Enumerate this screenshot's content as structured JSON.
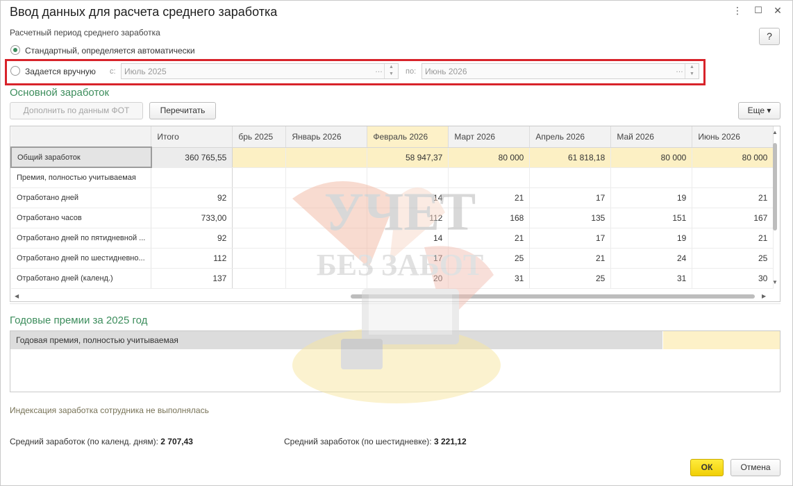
{
  "window": {
    "title": "Ввод данных для расчета среднего заработка",
    "controls": {
      "menu": "⋮",
      "minimize": "☐",
      "close": "✕"
    },
    "help": "?"
  },
  "period": {
    "label": "Расчетный период среднего заработка",
    "standard": "Стандартный, определяется автоматически",
    "manual": "Задается вручную",
    "from_label": "с:",
    "from_value": "Июль 2025",
    "to_label": "по:",
    "to_value": "Июнь 2026",
    "selected": "standard"
  },
  "main": {
    "title": "Основной заработок",
    "fill_button": "Дополнить по данным ФОТ",
    "recalc_button": "Перечитать",
    "more_button": "Еще ▾",
    "columns": [
      "",
      "Итого",
      "брь 2025",
      "Январь 2026",
      "Февраль 2026",
      "Март 2026",
      "Апрель 2026",
      "Май 2026",
      "Июнь 2026"
    ],
    "rows": [
      {
        "name": "Общий заработок",
        "total": "360 765,55",
        "cells": [
          "",
          "",
          "58 947,37",
          "80 000",
          "61 818,18",
          "80 000",
          "80 000"
        ]
      },
      {
        "name": "Премия, полностью учитываемая",
        "total": "",
        "cells": [
          "",
          "",
          "",
          "",
          "",
          "",
          ""
        ]
      },
      {
        "name": "Отработано дней",
        "total": "92",
        "cells": [
          "",
          "",
          "14",
          "21",
          "17",
          "19",
          "21"
        ]
      },
      {
        "name": "Отработано часов",
        "total": "733,00",
        "cells": [
          "",
          "",
          "112",
          "168",
          "135",
          "151",
          "167"
        ]
      },
      {
        "name": "Отработано дней по пятидневной ...",
        "total": "92",
        "cells": [
          "",
          "",
          "14",
          "21",
          "17",
          "19",
          "21"
        ]
      },
      {
        "name": "Отработано дней по шестидневно...",
        "total": "112",
        "cells": [
          "",
          "",
          "17",
          "25",
          "21",
          "24",
          "25"
        ]
      },
      {
        "name": "Отработано дней (календ.)",
        "total": "137",
        "cells": [
          "",
          "",
          "20",
          "31",
          "25",
          "31",
          "30"
        ]
      }
    ]
  },
  "bonuses": {
    "title": "Годовые премии за 2025 год",
    "row_label": "Годовая премия, полностью учитываемая"
  },
  "indexation_note": "Индексация заработка сотрудника не выполнялась",
  "averages": {
    "calendar_label": "Средний заработок (по календ. дням):",
    "calendar_value": "2 707,43",
    "six_day_label": "Средний заработок (по шестидневке):",
    "six_day_value": "3 221,12"
  },
  "footer": {
    "ok": "ОК",
    "cancel": "Отмена"
  },
  "watermark": {
    "line1": "УЧЕТ",
    "line2": "БЕЗ ЗАБОТ"
  },
  "colors": {
    "accent_green": "#3c8d5c",
    "highlight_red": "#d8232a",
    "ok_yellow": "#f5d80a",
    "cell_yellow": "#fcf0c4"
  }
}
